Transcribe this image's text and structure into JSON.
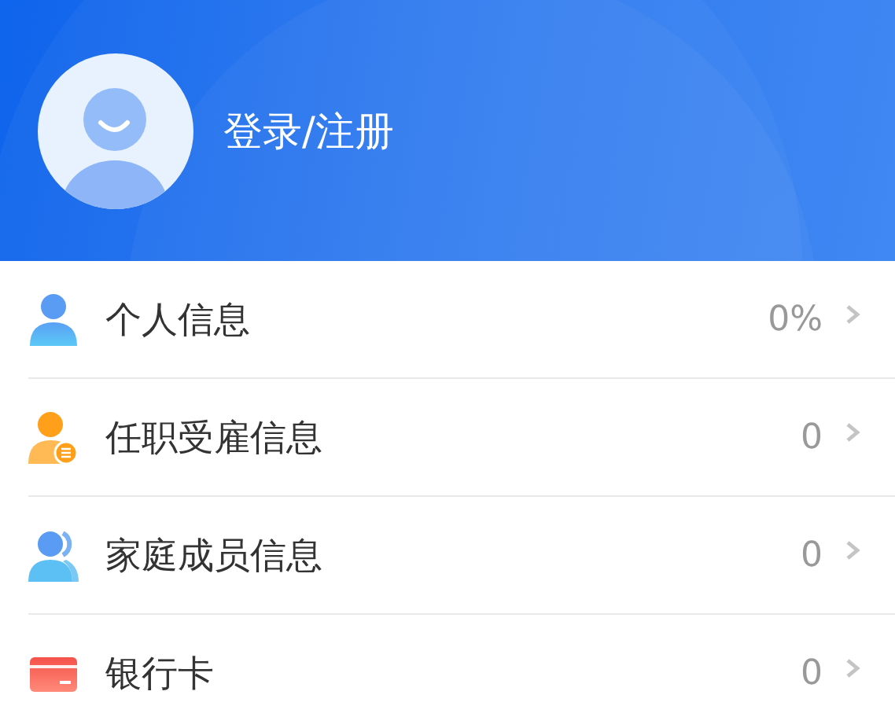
{
  "header": {
    "login_label": "登录/注册"
  },
  "items": [
    {
      "kind": "person",
      "label": "个人信息",
      "value": "0%"
    },
    {
      "kind": "employment",
      "label": "任职受雇信息",
      "value": "0"
    },
    {
      "kind": "family",
      "label": "家庭成员信息",
      "value": "0"
    },
    {
      "kind": "card",
      "label": "银行卡",
      "value": "0"
    }
  ]
}
